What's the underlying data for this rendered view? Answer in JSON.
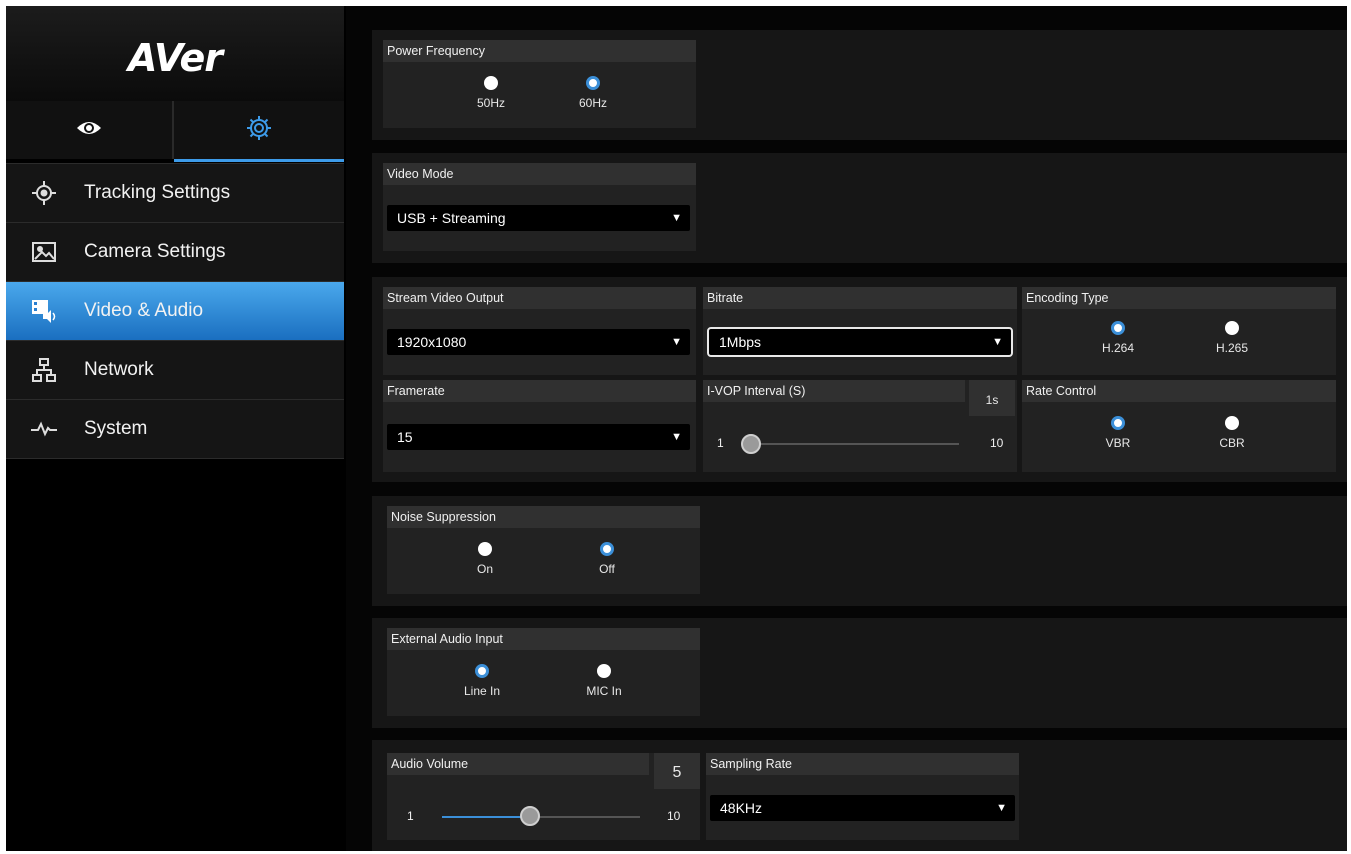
{
  "brand": {
    "logo_text": "AVer"
  },
  "colors": {
    "accent": "#3b8fd8",
    "active_nav_top": "#4aa8ec",
    "active_nav_bottom": "#1a6fc0",
    "panel": "#222222"
  },
  "top_tabs": [
    {
      "icon": "eye-icon",
      "active": false
    },
    {
      "icon": "gear-icon",
      "active": true
    }
  ],
  "sidebar": {
    "items": [
      {
        "label": "Tracking Settings",
        "icon": "target-icon",
        "active": false
      },
      {
        "label": "Camera Settings",
        "icon": "image-icon",
        "active": false
      },
      {
        "label": "Video & Audio",
        "icon": "video-audio-icon",
        "active": true
      },
      {
        "label": "Network",
        "icon": "network-icon",
        "active": false
      },
      {
        "label": "System",
        "icon": "pulse-icon",
        "active": false
      }
    ]
  },
  "power_frequency": {
    "title": "Power Frequency",
    "options": [
      {
        "label": "50Hz",
        "selected": false
      },
      {
        "label": "60Hz",
        "selected": true
      }
    ]
  },
  "video_mode": {
    "title": "Video Mode",
    "value": "USB + Streaming"
  },
  "stream_video_output": {
    "title": "Stream Video Output",
    "value": "1920x1080"
  },
  "bitrate": {
    "title": "Bitrate",
    "value": "1Mbps"
  },
  "encoding_type": {
    "title": "Encoding Type",
    "options": [
      {
        "label": "H.264",
        "selected": true
      },
      {
        "label": "H.265",
        "selected": false
      }
    ]
  },
  "framerate": {
    "title": "Framerate",
    "value": "15"
  },
  "ivop_interval": {
    "title": "I-VOP Interval (S)",
    "value_text": "1s",
    "min": "1",
    "max": "10",
    "value": 1
  },
  "rate_control": {
    "title": "Rate Control",
    "options": [
      {
        "label": "VBR",
        "selected": true
      },
      {
        "label": "CBR",
        "selected": false
      }
    ]
  },
  "noise_suppression": {
    "title": "Noise Suppression",
    "options": [
      {
        "label": "On",
        "selected": false
      },
      {
        "label": "Off",
        "selected": true
      }
    ]
  },
  "external_audio_input": {
    "title": "External Audio Input",
    "options": [
      {
        "label": "Line In",
        "selected": true
      },
      {
        "label": "MIC In",
        "selected": false
      }
    ]
  },
  "audio_volume": {
    "title": "Audio Volume",
    "value_text": "5",
    "min": "1",
    "max": "10",
    "value": 5
  },
  "sampling_rate": {
    "title": "Sampling Rate",
    "value": "48KHz"
  }
}
